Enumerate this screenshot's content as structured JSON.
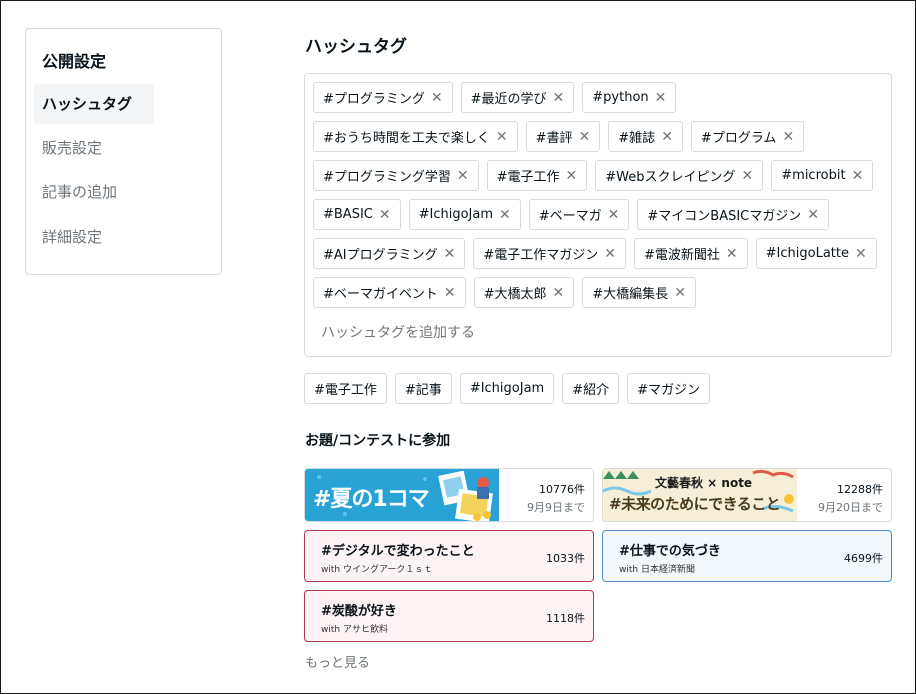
{
  "sidebar": {
    "title": "公開設定",
    "items": [
      {
        "label": "ハッシュタグ"
      },
      {
        "label": "販売設定"
      },
      {
        "label": "記事の追加"
      },
      {
        "label": "詳細設定"
      }
    ]
  },
  "hashtags": {
    "title": "ハッシュタグ",
    "tags": [
      "#プログラミング",
      "#最近の学び",
      "#python",
      "#おうち時間を工夫で楽しく",
      "#書評",
      "#雑誌",
      "#プログラム",
      "#プログラミング学習",
      "#電子工作",
      "#Webスクレイピング",
      "#microbit",
      "#BASIC",
      "#IchigoJam",
      "#ベーマガ",
      "#マイコンBASICマガジン",
      "#AIプログラミング",
      "#電子工作マガジン",
      "#電波新聞社",
      "#IchigoLatte",
      "#ベーマガイベント",
      "#大橋太郎",
      "#大橋編集長"
    ],
    "remove_glyph": "✕",
    "input_placeholder": "ハッシュタグを追加する",
    "suggested": [
      "#電子工作",
      "#記事",
      "#IchigoJam",
      "#紹介",
      "#マガジン"
    ]
  },
  "contests": {
    "title": "お題/コンテストに参加",
    "featured": [
      {
        "banner_text": "#夏の1コマ",
        "count": "10776件",
        "deadline": "9月9日まで",
        "color": "#29a3d6"
      },
      {
        "banner_text": "#未来のためにできること",
        "banner_top": "文藝春秋 × note",
        "count": "12288件",
        "deadline": "9月20日まで",
        "color": "#f6efd8"
      }
    ],
    "items": [
      {
        "title": "#デジタルで変わったこと",
        "with": "with ウイングアーク１ｓｔ",
        "count": "1033件",
        "color": "#b03c54"
      },
      {
        "title": "#仕事での気づき",
        "with": "with 日本経済新聞",
        "count": "4699件",
        "color": "#4a8ac6"
      },
      {
        "title": "#炭酸が好き",
        "with": "with アサヒ飲料",
        "count": "1118件",
        "color": "#b03c54"
      }
    ],
    "more_label": "もっと見る"
  }
}
